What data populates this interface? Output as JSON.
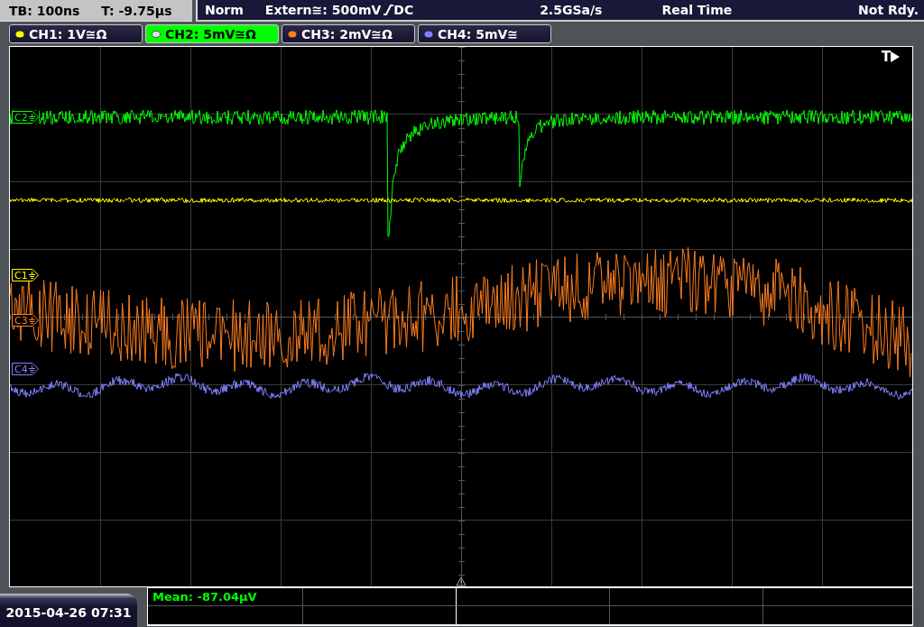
{
  "header": {
    "timebase": "TB: 100ns",
    "trigger_time": "T: -9.75µs",
    "mode": "Norm",
    "trigger_source": "Extern≅: 500mV",
    "coupling": "DC",
    "sample_rate": "2.5GSa/s",
    "acquisition": "Real Time",
    "status": "Not Rdy."
  },
  "channels": [
    {
      "label": "CH1: 1V≅Ω",
      "color": "#ffff00",
      "selected": false
    },
    {
      "label": "CH2: 5mV≅Ω",
      "color": "#00ff00",
      "selected": true
    },
    {
      "label": "CH3: 2mV≅Ω",
      "color": "#ff7f1e",
      "selected": false
    },
    {
      "label": "CH4: 5mV≅",
      "color": "#8080ff",
      "selected": false
    }
  ],
  "markers": [
    {
      "label": "C2",
      "color": "#00ff00"
    },
    {
      "label": "C1",
      "color": "#ffff00"
    },
    {
      "label": "C3",
      "color": "#ff7f1e"
    },
    {
      "label": "C4",
      "color": "#8080ff"
    }
  ],
  "trigger_label": "T",
  "date_time": "2015-04-26 07:31",
  "measurements": [
    "Mean: -87.04µV"
  ]
}
